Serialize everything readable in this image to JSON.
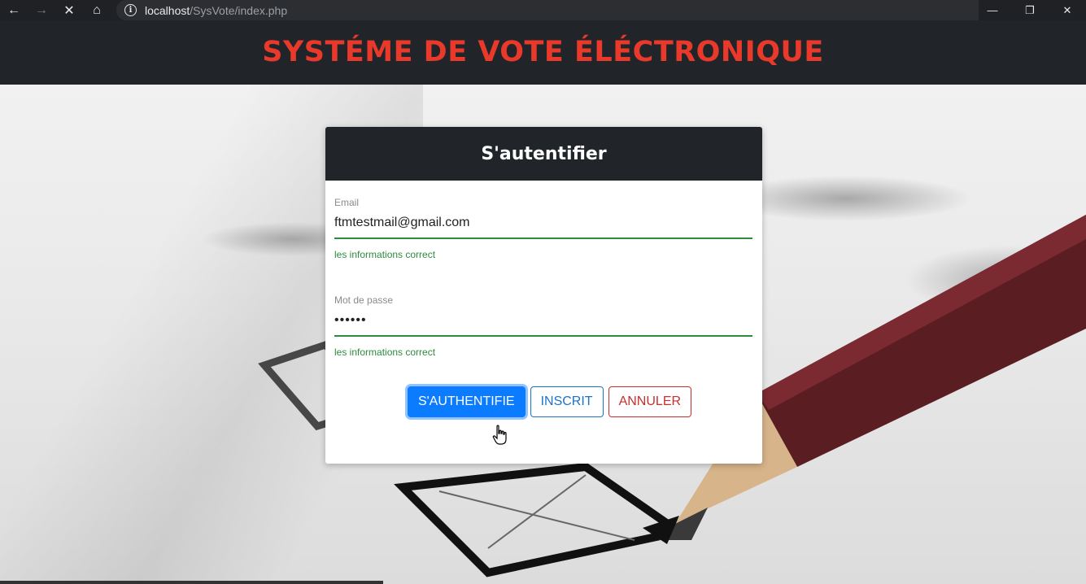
{
  "browser": {
    "back_icon": "←",
    "forward_icon": "→",
    "stop_icon": "✕",
    "home_icon": "⌂",
    "url_host": "localhost",
    "url_path": "/SysVote/index.php",
    "minimize_icon": "—",
    "restore_icon": "❐",
    "close_icon": "✕"
  },
  "header": {
    "title": "SYSTÉME DE VOTE ÉLÉCTRONIQUE",
    "title_color": "#e8392b"
  },
  "login": {
    "title": "S'autentifier",
    "email": {
      "label": "Email",
      "value": "ftmtestmail@gmail.com",
      "help": "les informations correct"
    },
    "password": {
      "label": "Mot de passe",
      "value": "••••••",
      "help": "les informations correct"
    },
    "buttons": {
      "submit": "S'AUTHENTIFIE",
      "register": "INSCRIT",
      "cancel": "ANNULER"
    }
  }
}
